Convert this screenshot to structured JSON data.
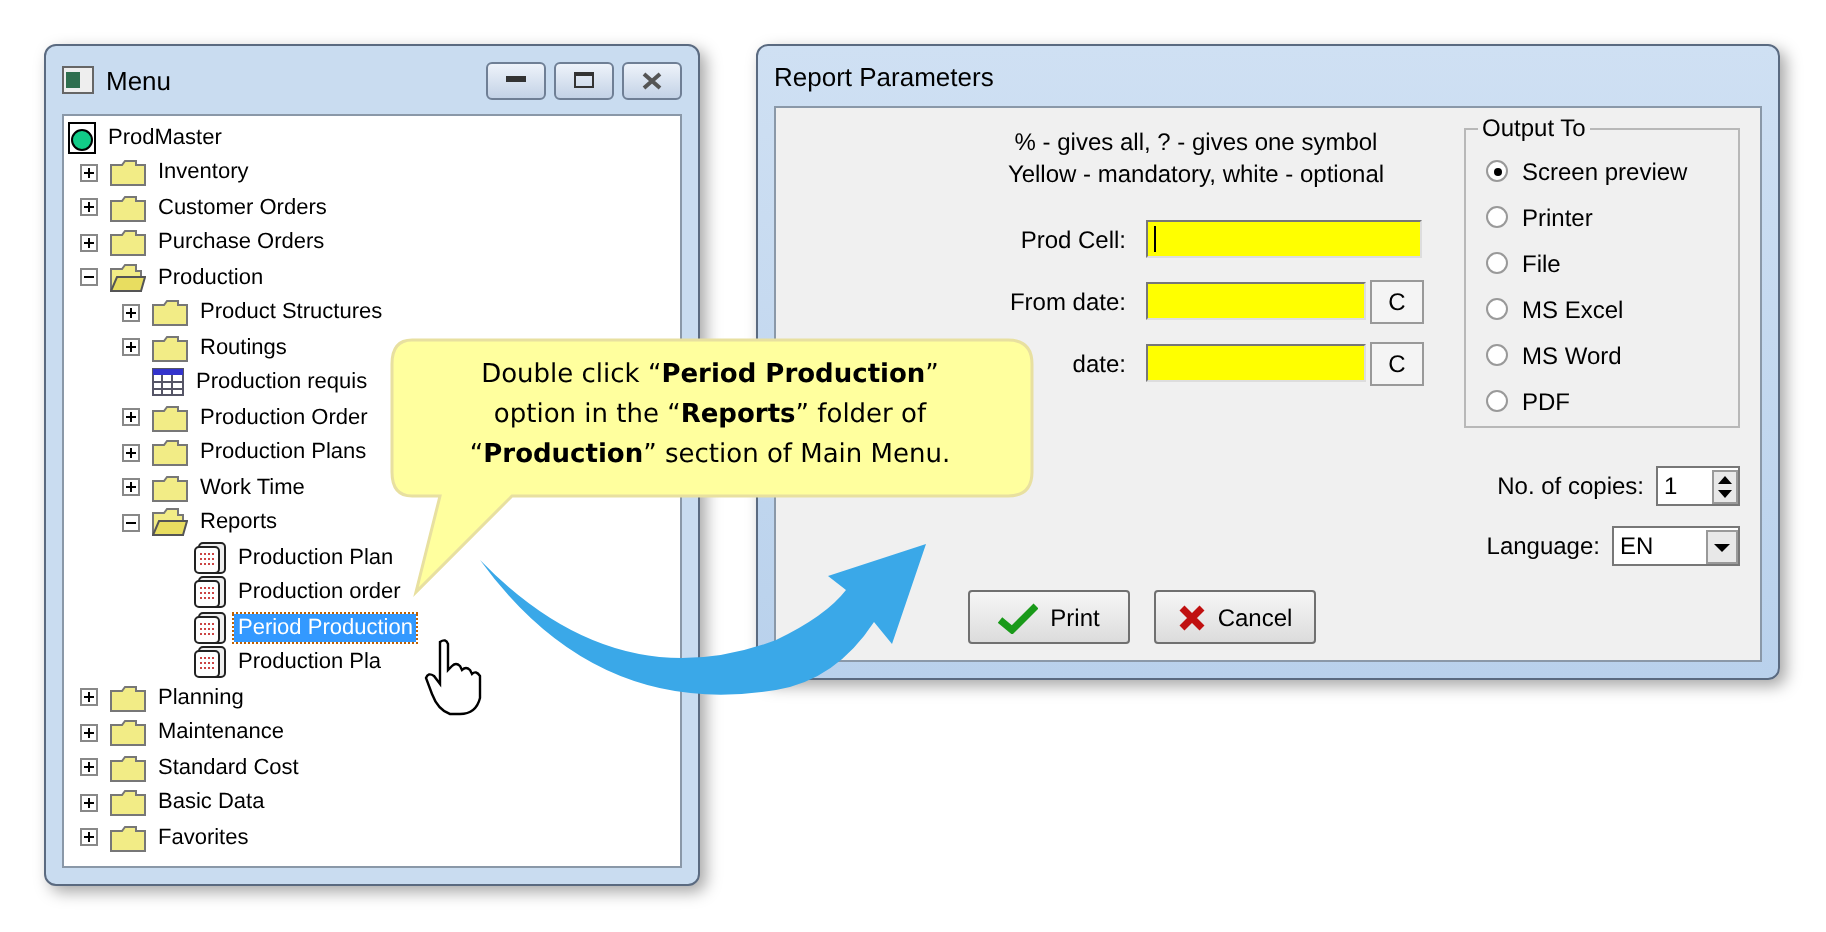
{
  "menu": {
    "title": "Menu",
    "tree": [
      {
        "label": "ProdMaster",
        "kind": "root",
        "selected": false,
        "children": [
          {
            "label": "Inventory",
            "kind": "folder",
            "expanded": false,
            "selected": false
          },
          {
            "label": "Customer Orders",
            "kind": "folder",
            "expanded": false,
            "selected": false
          },
          {
            "label": "Purchase Orders",
            "kind": "folder",
            "expanded": false,
            "selected": false
          },
          {
            "label": "Production",
            "kind": "folder",
            "expanded": true,
            "selected": false,
            "children": [
              {
                "label": "Product Structures",
                "kind": "folder",
                "expanded": false,
                "selected": false
              },
              {
                "label": "Routings",
                "kind": "folder",
                "expanded": false,
                "selected": false
              },
              {
                "label": "Production requis",
                "kind": "grid",
                "selected": false
              },
              {
                "label": "Production Order",
                "kind": "folder",
                "expanded": false,
                "selected": false
              },
              {
                "label": "Production Plans",
                "kind": "folder",
                "expanded": false,
                "selected": false
              },
              {
                "label": "Work Time",
                "kind": "folder",
                "expanded": false,
                "selected": false
              },
              {
                "label": "Reports",
                "kind": "folder",
                "expanded": true,
                "selected": false,
                "children": [
                  {
                    "label": "Production Plan",
                    "kind": "report",
                    "selected": false
                  },
                  {
                    "label": "Production order",
                    "kind": "report",
                    "selected": false
                  },
                  {
                    "label": "Period Production",
                    "kind": "report",
                    "selected": true
                  },
                  {
                    "label": "Production Pla",
                    "kind": "report",
                    "selected": false
                  }
                ]
              }
            ]
          },
          {
            "label": "Planning",
            "kind": "folder",
            "expanded": false,
            "selected": false
          },
          {
            "label": "Maintenance",
            "kind": "folder",
            "expanded": false,
            "selected": false
          },
          {
            "label": "Standard Cost",
            "kind": "folder",
            "expanded": false,
            "selected": false
          },
          {
            "label": "Basic Data",
            "kind": "folder",
            "expanded": false,
            "selected": false
          },
          {
            "label": "Favorites",
            "kind": "folder",
            "expanded": false,
            "selected": false
          }
        ]
      }
    ]
  },
  "callout": {
    "text": "Double click “**Period Production**” option in the “**Reports**” folder of “**Production**” section of Main Menu."
  },
  "dialog": {
    "title": "Report Parameters",
    "hints": [
      "% - gives all, ? - gives one symbol",
      "Yellow - mandatory, white - optional"
    ],
    "fields": [
      {
        "label": "Prod Cell:",
        "kind": "text",
        "mandatory": true
      },
      {
        "label": "From date:",
        "kind": "date",
        "mandatory": true,
        "button": "C"
      },
      {
        "label": "date:",
        "kind": "date",
        "mandatory": true,
        "button": "C"
      }
    ],
    "output_to": {
      "title": "Output To",
      "options": [
        {
          "label": "Screen preview",
          "selected": true
        },
        {
          "label": "Printer",
          "selected": false
        },
        {
          "label": "File",
          "selected": false
        },
        {
          "label": "MS Excel",
          "selected": false
        },
        {
          "label": "MS Word",
          "selected": false
        },
        {
          "label": "PDF",
          "selected": false
        }
      ]
    },
    "copies": {
      "label": "No. of copies:",
      "value": "1"
    },
    "language": {
      "label": "Language:",
      "value": "EN"
    },
    "buttons": [
      {
        "label": "Print",
        "kind": "ok"
      },
      {
        "label": "Cancel",
        "kind": "cancel"
      }
    ]
  }
}
